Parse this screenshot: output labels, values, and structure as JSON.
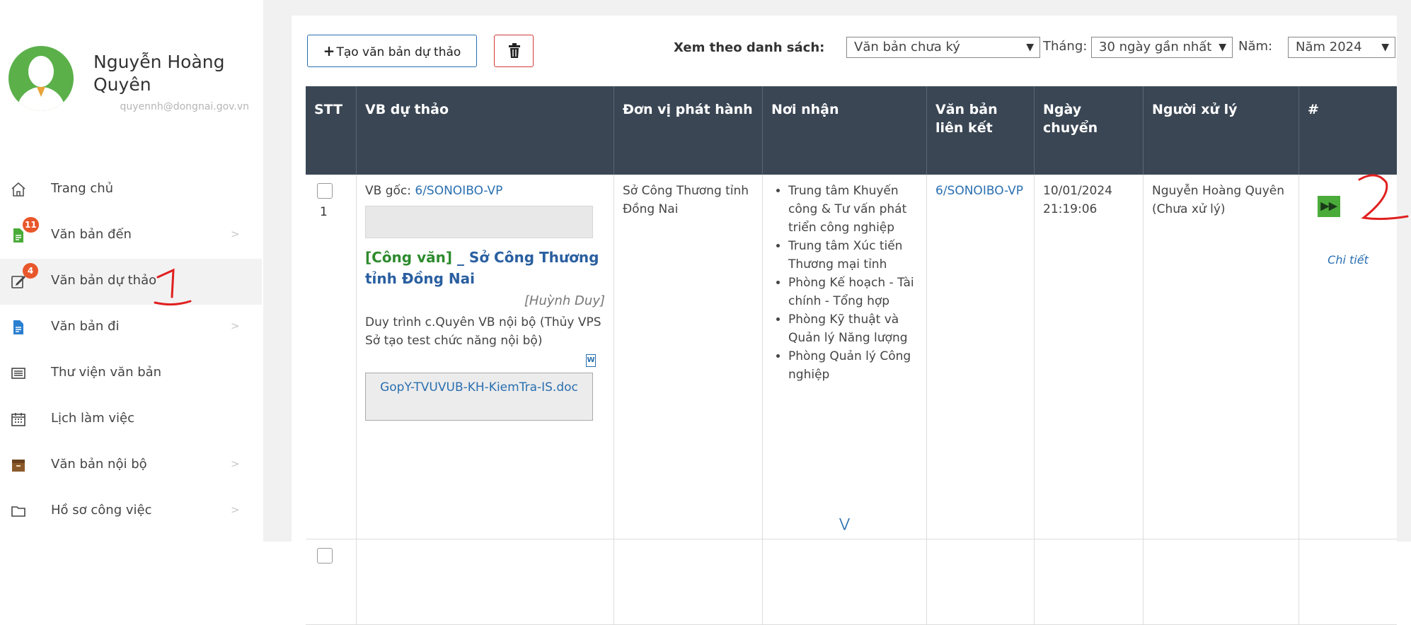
{
  "user": {
    "name": "Nguyễn Hoàng Quyên",
    "email": "quyennh@dongnai.gov.vn"
  },
  "sidebar": {
    "items": [
      {
        "label": "Trang chủ",
        "icon": "home-icon"
      },
      {
        "label": "Văn bản đến",
        "icon": "incoming-document-icon",
        "badge": "11",
        "has_chevron": true
      },
      {
        "label": "Văn bản dự thảo",
        "icon": "draft-edit-icon",
        "badge": "4",
        "active": true
      },
      {
        "label": "Văn bản đi",
        "icon": "outgoing-document-icon",
        "has_chevron": true
      },
      {
        "label": "Thư viện văn bản",
        "icon": "library-icon"
      },
      {
        "label": "Lịch làm việc",
        "icon": "calendar-icon"
      },
      {
        "label": "Văn bản nội bộ",
        "icon": "archive-box-icon",
        "has_chevron": true
      },
      {
        "label": "Hồ sơ công việc",
        "icon": "folder-icon",
        "has_chevron": true
      }
    ]
  },
  "toolbar": {
    "create_label": "Tạo văn bản dự thảo",
    "filter_label": "Xem theo danh sách:",
    "list_selected": "Văn bản chưa ký",
    "month_label": "Tháng:",
    "month_selected": "30 ngày gần nhất",
    "year_label": "Năm:",
    "year_selected": "Năm 2024"
  },
  "table": {
    "columns": [
      "STT",
      "VB dự thảo",
      "Đơn vị phát hành",
      "Nơi nhận",
      "Văn bản liên kết",
      "Ngày chuyển",
      "Người xử lý",
      "#"
    ],
    "rows": [
      {
        "stt": "1",
        "vb_goc_label": "VB gốc:",
        "vb_goc_link": "6/SONOIBO-VP",
        "doc_type": "[Công văn]",
        "doc_org": "_ Sở Công Thương tỉnh Đồng Nai",
        "author": "[Huỳnh Duy]",
        "summary": "Duy trình c.Quyên VB nội bộ (Thủy VPS Sở tạo test chức năng nội bộ)",
        "attachment": "GopY-TVUVUB-KH-KiemTra-IS.doc",
        "issuer": "Sở Công Thương tỉnh Đồng Nai",
        "recipients": [
          "Trung tâm Khuyến công & Tư vấn phát triển công nghiệp",
          "Trung tâm Xúc tiến Thương mại tỉnh",
          "Phòng Kế hoạch - Tài chính - Tổng hợp",
          "Phòng Kỹ thuật và Quản lý Năng lượng",
          "Phòng Quản lý Công nghiệp"
        ],
        "linked": "6/SONOIBO-VP",
        "date": "10/01/2024 21:19:06",
        "handler": "Nguyễn Hoàng Quyên (Chưa xử lý)",
        "detail_label": "Chi tiết"
      }
    ]
  },
  "colors": {
    "header_bg": "#3a4654",
    "link": "#2a6fb0",
    "badge": "#e8572b",
    "go_button": "#4aab3a",
    "annotation": "#e02020"
  }
}
